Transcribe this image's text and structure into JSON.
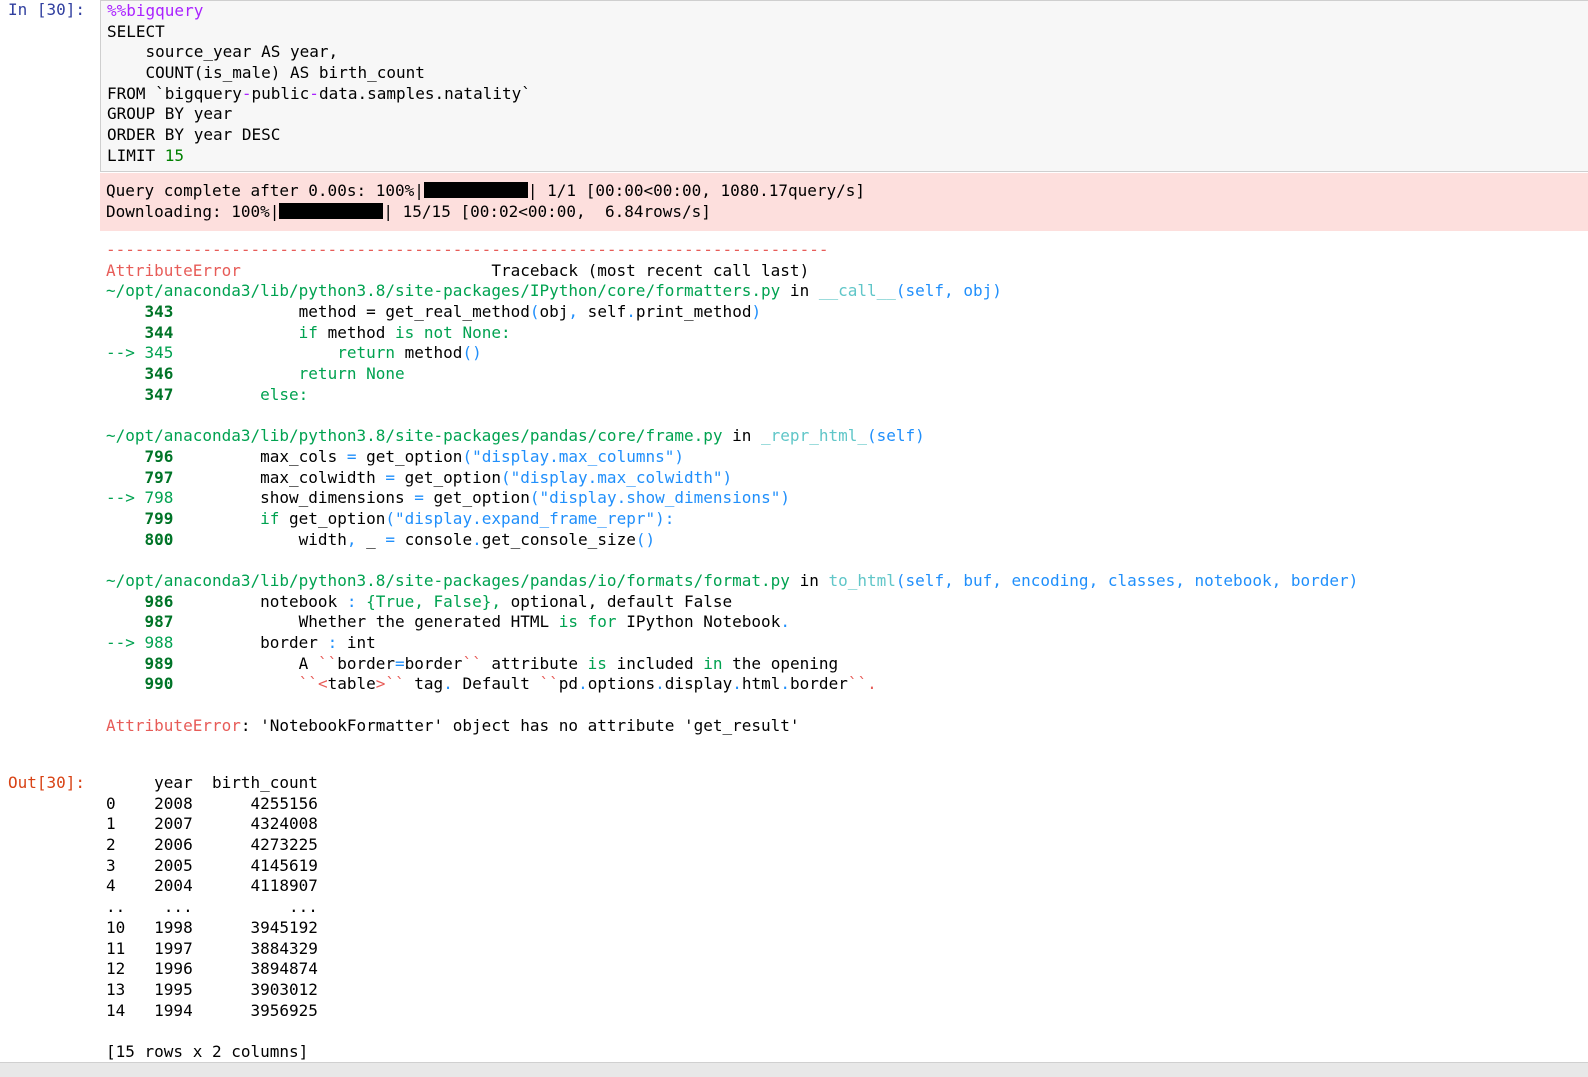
{
  "cell": {
    "in_prompt": "In [30]:",
    "out_prompt": "Out[30]:",
    "code": {
      "magic": "%%bigquery",
      "l1": "SELECT",
      "l2": "    source_year AS year,",
      "l3": "    COUNT(is_male) AS birth_count",
      "l4a": "FROM `bigquery",
      "l4b": "-",
      "l4c": "public",
      "l4d": "-",
      "l4e": "data.samples.natality`",
      "l5": "GROUP BY year",
      "l6": "ORDER BY year DESC",
      "l7a": "LIMIT ",
      "l7b": "15"
    }
  },
  "stderr": {
    "query_prefix": "Query complete after 0.00s: 100%|",
    "query_suffix": "| 1/1 [00:00<00:00, 1080.17query/s]",
    "download_prefix": "Downloading: 100%|",
    "download_suffix": "| 15/15 [00:02<00:00,  6.84rows/s]"
  },
  "traceback": {
    "dashes": "---------------------------------------------------------------------------",
    "error_name": "AttributeError",
    "header_right": "                          Traceback (most recent call last)",
    "frame1": {
      "path": "~/opt/anaconda3/lib/python3.8/site-packages/IPython/core/formatters.py",
      "in": " in ",
      "func": "__call__",
      "args": "(self, obj)",
      "n343": "    343",
      "n344": "    344",
      "a345": "--> 345",
      "n346": "    346",
      "n347": "    347",
      "c343a": "             method ",
      "c343b": "=",
      "c343c": " get_real_method",
      "c343d": "(",
      "c343e": "obj",
      "c343f": ",",
      "c343g": " self",
      "c343h": ".",
      "c343i": "print_method",
      "c343j": ")",
      "c344a": "             if",
      "c344b": " method ",
      "c344c": "is",
      "c344d": " ",
      "c344e": "not",
      "c344f": " None:",
      "c345a": "                 return",
      "c345b": " method",
      "c345c": "()",
      "c346a": "             return",
      "c346b": " None",
      "c347a": "         else:"
    },
    "frame2": {
      "path": "~/opt/anaconda3/lib/python3.8/site-packages/pandas/core/frame.py",
      "in": " in ",
      "func": "_repr_html_",
      "args": "(self)",
      "n796": "    796",
      "n797": "    797",
      "a798": "--> 798",
      "n799": "    799",
      "n800": "    800",
      "c796a": "         max_cols ",
      "c796b": "=",
      "c796c": " get_option",
      "c796d": "(\"display.max_columns\")",
      "c797a": "         max_colwidth ",
      "c797b": "=",
      "c797c": " get_option",
      "c797d": "(\"display.max_colwidth\")",
      "c798a": "         show_dimensions ",
      "c798b": "=",
      "c798c": " get_option",
      "c798d": "(\"display.show_dimensions\")",
      "c799a": "         if",
      "c799b": " get_option",
      "c799c": "(\"display.expand_frame_repr\"):",
      "c800a": "             width",
      "c800b": ",",
      "c800c": " _ ",
      "c800d": "=",
      "c800e": " console",
      "c800f": ".",
      "c800g": "get_console_size",
      "c800h": "()"
    },
    "frame3": {
      "path": "~/opt/anaconda3/lib/python3.8/site-packages/pandas/io/formats/format.py",
      "in": " in ",
      "func": "to_html",
      "args": "(self, buf, encoding, classes, notebook, border)",
      "n986": "    986",
      "n987": "    987",
      "a988": "--> 988",
      "n989": "    989",
      "n990": "    990",
      "c986a": "         notebook ",
      "c986b": ":",
      "c986c": " {True, False}, ",
      "c986d": "optional, default False",
      "c987a": "             Whether the generated HTML ",
      "c987b": "is",
      "c987c": " ",
      "c987d": "for",
      "c987e": " IPython Notebook",
      "c987f": ".",
      "c988a": "         border ",
      "c988b": ":",
      "c988c": " int",
      "c989a": "             A ",
      "c989b": "``",
      "c989c": "border",
      "c989d": "=",
      "c989e": "border",
      "c989f": "``",
      "c989g": " attribute ",
      "c989h": "is",
      "c989i": " included ",
      "c989j": "in",
      "c989k": " the opening",
      "c990a": "             ",
      "c990b": "``<",
      "c990c": "table",
      "c990d": ">``",
      "c990e": " tag",
      "c990f": ".",
      "c990g": " Default ",
      "c990h": "``",
      "c990i": "pd",
      "c990j": ".",
      "c990k": "options",
      "c990l": ".",
      "c990m": "display",
      "c990n": ".",
      "c990o": "html",
      "c990p": ".",
      "c990q": "border",
      "c990r": "``.",
      "c990s": ""
    },
    "final_error_name": "AttributeError",
    "final_message": ": 'NotebookFormatter' object has no attribute 'get_result'"
  },
  "dataframe": {
    "header": "     year  birth_count",
    "rows": [
      "0    2008      4255156",
      "1    2007      4324008",
      "2    2006      4273225",
      "3    2005      4145619",
      "4    2004      4118907",
      "..    ...          ...",
      "10   1998      3945192",
      "11   1997      3884329",
      "12   1996      3894874",
      "13   1995      3903012",
      "14   1994      3956925"
    ],
    "footer": "[15 rows x 2 columns]"
  }
}
